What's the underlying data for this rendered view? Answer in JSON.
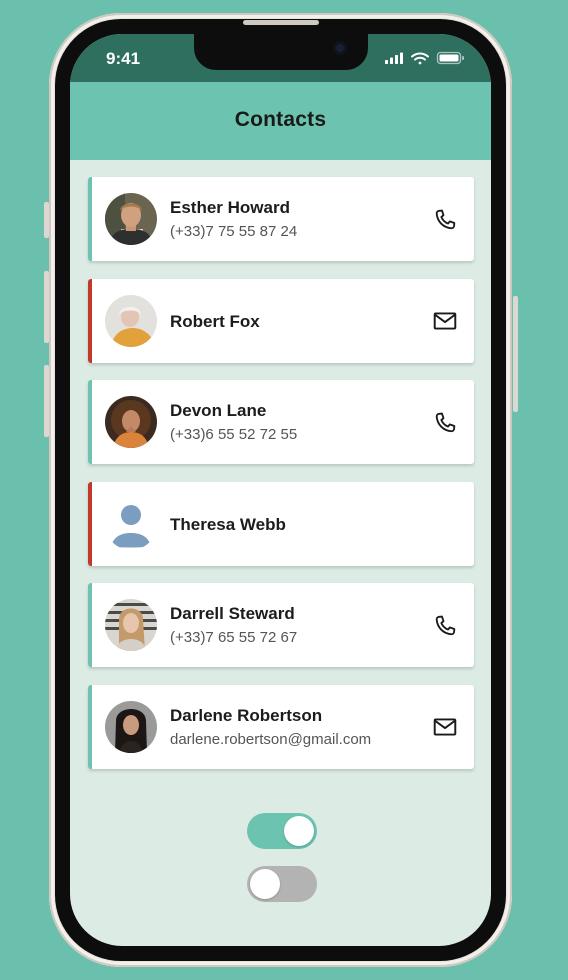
{
  "status_bar": {
    "time": "9:41"
  },
  "header": {
    "title": "Contacts"
  },
  "contacts": [
    {
      "name": "Esther Howard",
      "detail": "(+33)7 75 55 87 24",
      "accent": "#6bc3b0",
      "action_icon": "phone-icon"
    },
    {
      "name": "Robert Fox",
      "detail": "",
      "accent": "#c0392b",
      "action_icon": "mail-icon"
    },
    {
      "name": "Devon Lane",
      "detail": "(+33)6 55 52 72 55",
      "accent": "#6bc3b0",
      "action_icon": "phone-icon"
    },
    {
      "name": "Theresa Webb",
      "detail": "",
      "accent": "#c0392b",
      "action_icon": ""
    },
    {
      "name": "Darrell Steward",
      "detail": "(+33)7 65 55 72 67",
      "accent": "#6bc3b0",
      "action_icon": "phone-icon"
    },
    {
      "name": "Darlene Robertson",
      "detail": "darlene.robertson@gmail.com",
      "accent": "#6bc3b0",
      "action_icon": "mail-icon"
    }
  ],
  "toggles": [
    {
      "state": "on",
      "color": "#6bc3b0"
    },
    {
      "state": "off",
      "color": "#b3b3b3"
    }
  ],
  "colors": {
    "background": "#6bbfad",
    "header": "#6bc3b0",
    "screen": "#dcece5",
    "status_bar": "#2f6f5f"
  }
}
